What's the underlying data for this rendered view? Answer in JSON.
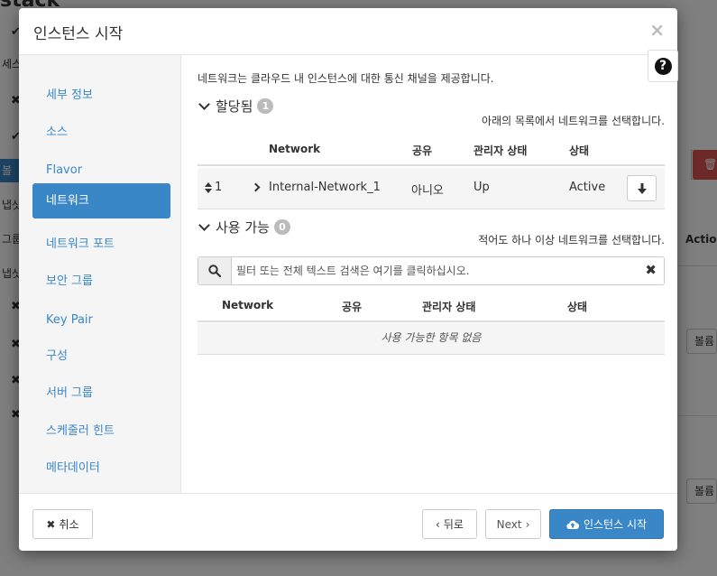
{
  "background": {
    "brand": "stack",
    "left_items": [
      "세스",
      "볼륨",
      "냅샷",
      "그룹",
      "냅샷"
    ],
    "action_header": "Action",
    "row_button": "볼륨"
  },
  "modal": {
    "title": "인스턴스 시작",
    "help_symbol": "?",
    "close_symbol": "×"
  },
  "sidebar": {
    "items": [
      {
        "label": "세부 정보"
      },
      {
        "label": "소스"
      },
      {
        "label": "Flavor"
      },
      {
        "label": "네트워크",
        "active": true
      },
      {
        "label": "네트워크 포트"
      },
      {
        "label": "보안 그룹"
      },
      {
        "label": "Key Pair"
      },
      {
        "label": "구성"
      },
      {
        "label": "서버 그룹"
      },
      {
        "label": "스케줄러 힌트"
      },
      {
        "label": "메타데이터"
      }
    ]
  },
  "content": {
    "description": "네트워크는 클라우드 내 인스턴스에 대한 통신 채널을 제공합니다.",
    "allocated": {
      "title": "할당됨",
      "count": "1",
      "hint": "아래의 목록에서 네트워크를 선택합니다.",
      "columns": {
        "network": "Network",
        "shared": "공유",
        "admin_state": "관리자 상태",
        "status": "상태"
      },
      "rows": [
        {
          "order": "1",
          "network": "Internal-Network_1",
          "shared": "아니오",
          "admin_state": "Up",
          "status": "Active"
        }
      ]
    },
    "available": {
      "title": "사용 가능",
      "count": "0",
      "hint": "적어도 하나 이상 네트워크를 선택합니다.",
      "filter_placeholder": "필터 또는 전체 텍스트 검색은 여기를 클릭하십시오.",
      "columns": {
        "network": "Network",
        "shared": "공유",
        "admin_state": "관리자 상태",
        "status": "상태"
      },
      "empty_text": "사용 가능한 항목 없음"
    }
  },
  "footer": {
    "cancel": "취소",
    "back": "뒤로",
    "next": "Next",
    "launch": "인스턴스 시작"
  },
  "colors": {
    "accent": "#3a87c8",
    "danger": "#d9534f"
  }
}
